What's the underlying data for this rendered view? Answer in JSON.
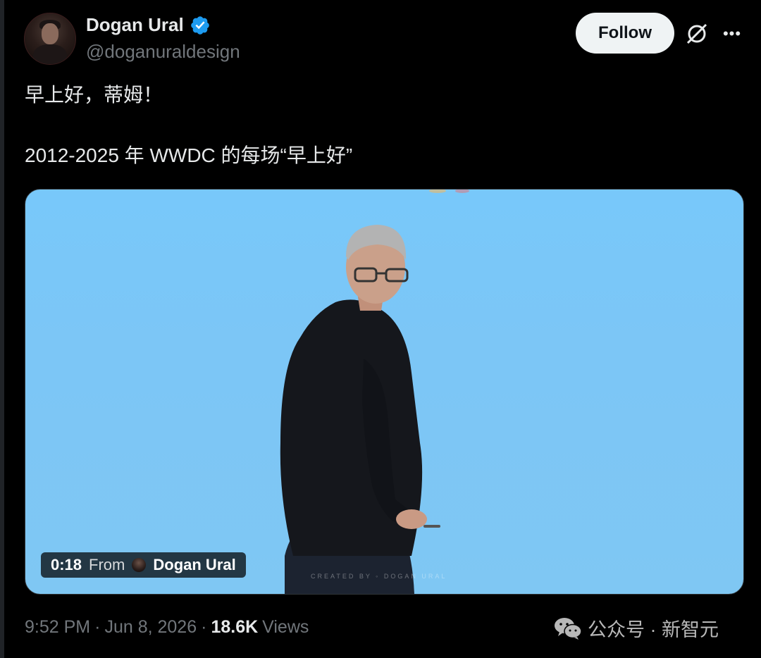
{
  "author": {
    "name": "Dogan Ural",
    "handle": "@doganuraldesign",
    "verified_icon": "verified-badge-icon",
    "verified_color": "#1d9bf0"
  },
  "actions": {
    "follow_label": "Follow",
    "grok_icon": "grok-icon",
    "more_icon": "more-icon"
  },
  "tweet": {
    "line1": "早上好，蒂姆！",
    "line2": "2012-2025 年 WWDC 的每场“早上好”"
  },
  "video": {
    "timestamp": "0:18",
    "from_label": "From",
    "from_name": "Dogan Ural",
    "watermark": "CREATED BY ◦ DOGAN URAL",
    "background_color": "#7cc6f6"
  },
  "meta": {
    "time": "9:52 PM",
    "separator": "·",
    "date": "Jun 8, 2026",
    "views_count": "18.6K",
    "views_label": "Views"
  },
  "overlay": {
    "wechat_icon": "wechat-icon",
    "text": "公众号 · 新智元"
  }
}
